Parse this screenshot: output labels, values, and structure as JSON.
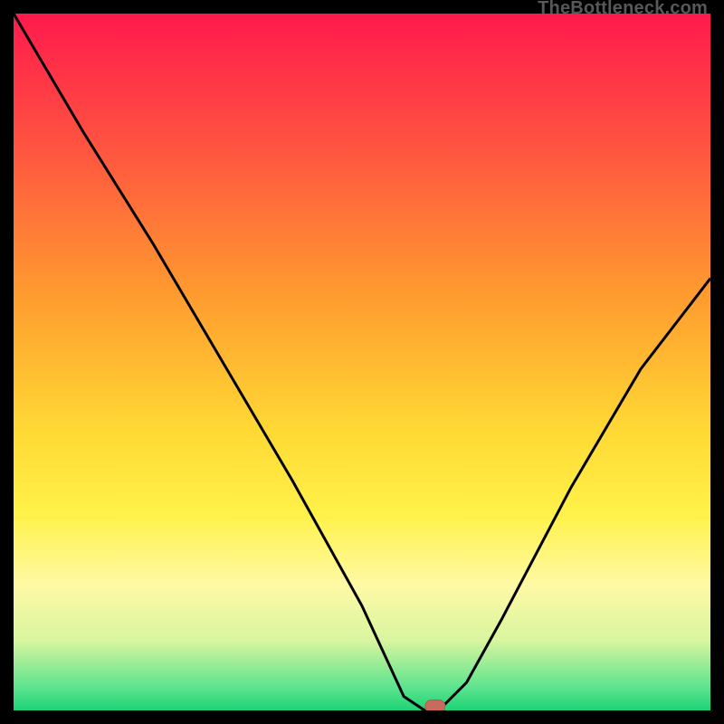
{
  "watermark": "TheBottleneck.com",
  "chart_data": {
    "type": "line",
    "title": "",
    "xlabel": "",
    "ylabel": "",
    "xlim": [
      0,
      100
    ],
    "ylim": [
      0,
      100
    ],
    "series": [
      {
        "name": "bottleneck-curve",
        "x": [
          0,
          10,
          20,
          30,
          40,
          50,
          56,
          59,
          61,
          65,
          70,
          80,
          90,
          100
        ],
        "values": [
          100,
          83,
          67,
          50,
          33,
          15,
          2,
          0,
          0,
          4,
          13,
          32,
          49,
          62
        ]
      }
    ],
    "marker": {
      "x": 60.5,
      "y": 0.6
    },
    "gradient_stops": [
      {
        "offset": 0.0,
        "color": "#ff1a4d"
      },
      {
        "offset": 0.2,
        "color": "#ff5640"
      },
      {
        "offset": 0.4,
        "color": "#ff9a2f"
      },
      {
        "offset": 0.6,
        "color": "#ffd934"
      },
      {
        "offset": 0.72,
        "color": "#fff24a"
      },
      {
        "offset": 0.82,
        "color": "#fff9a5"
      },
      {
        "offset": 0.9,
        "color": "#d8f59f"
      },
      {
        "offset": 0.97,
        "color": "#57e28d"
      },
      {
        "offset": 1.0,
        "color": "#1dd476"
      }
    ],
    "colors": {
      "frame": "#000000",
      "curve": "#000000",
      "marker_fill": "#c86b5e",
      "marker_stroke": "#b45a4d"
    }
  }
}
